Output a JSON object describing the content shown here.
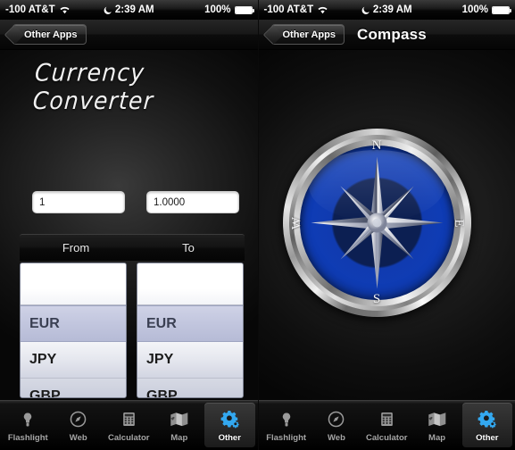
{
  "left": {
    "status": {
      "carrier": "-100 AT&T",
      "wifi_icon": "wifi-icon",
      "moon_icon": "moon-icon",
      "time": "2:39 AM",
      "battery_pct": "100%",
      "battery_icon": "battery-icon"
    },
    "nav": {
      "back_label": "Other Apps",
      "title": ""
    },
    "title": "Currency Converter",
    "fields": {
      "amount_value": "1",
      "amount_placeholder": "1",
      "result_value": "1.0000",
      "result_placeholder": "1.0000"
    },
    "picker": {
      "columns": [
        "From",
        "To"
      ],
      "from_rows": [
        "",
        "EUR",
        "JPY",
        "GBP"
      ],
      "to_rows": [
        "",
        "EUR",
        "JPY",
        "GBP"
      ],
      "from_selected": "EUR",
      "to_selected": "EUR"
    }
  },
  "right": {
    "status": {
      "carrier": "-100 AT&T",
      "wifi_icon": "wifi-icon",
      "moon_icon": "moon-icon",
      "time": "2:39 AM",
      "battery_pct": "100%",
      "battery_icon": "battery-icon"
    },
    "nav": {
      "back_label": "Other Apps",
      "title": "Compass"
    },
    "compass": {
      "north": "N",
      "east": "E",
      "south": "S",
      "west": "W",
      "face_color": "#1040c0",
      "bezel_color": "#c9c9c9"
    }
  },
  "tabs": [
    {
      "label": "Flashlight",
      "icon": "flashlight-icon",
      "active": false
    },
    {
      "label": "Web",
      "icon": "compass-web-icon",
      "active": false
    },
    {
      "label": "Calculator",
      "icon": "calculator-icon",
      "active": false
    },
    {
      "label": "Map",
      "icon": "map-icon",
      "active": false
    },
    {
      "label": "Other",
      "icon": "gear-icon",
      "active": true
    }
  ],
  "accent": {
    "active_tab_icon": "#33a8f0",
    "inactive_tab_icon": "#8c8c8c"
  }
}
